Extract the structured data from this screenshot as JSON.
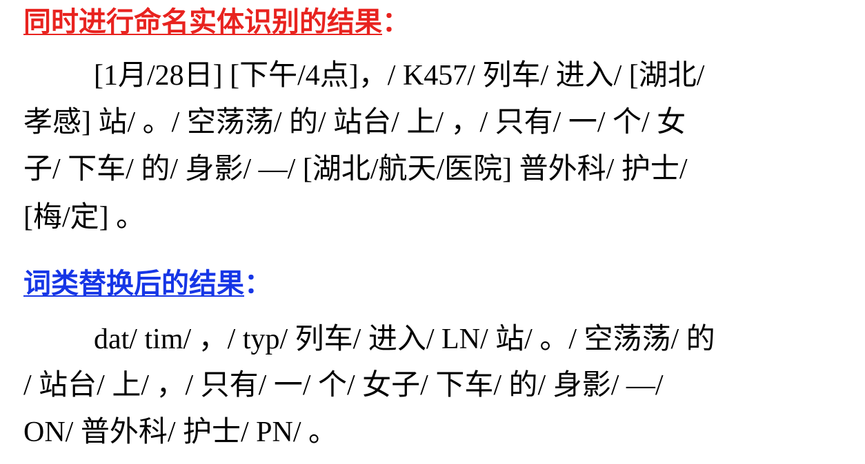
{
  "section1": {
    "heading": "同时进行命名实体识别的结果",
    "colon": "：",
    "lines": [
      "[1月/28日] [下午/4点]，/ K457/ 列车/ 进入/ [湖北/",
      "孝感] 站/ 。/ 空荡荡/ 的/ 站台/ 上/ ，/ 只有/ 一/ 个/ 女",
      "子/ 下车/ 的/ 身影/ —/ [湖北/航天/医院] 普外科/ 护士/",
      "[梅/定] 。"
    ]
  },
  "section2": {
    "heading": "词类替换后的结果",
    "colon": "：",
    "lines": [
      "dat/ tim/ ，/ typ/ 列车/ 进入/ LN/ 站/ 。/ 空荡荡/ 的",
      "/ 站台/ 上/ ，/ 只有/ 一/ 个/ 女子/ 下车/ 的/ 身影/ —/",
      "ON/ 普外科/ 护士/ PN/ 。"
    ]
  },
  "colors": {
    "heading1": "#e8231f",
    "heading2": "#1636e6"
  }
}
